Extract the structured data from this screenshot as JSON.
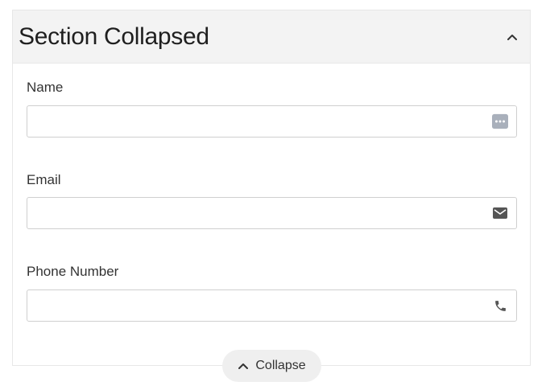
{
  "section": {
    "title": "Section Collapsed",
    "toggle_icon": "chevron-up-icon"
  },
  "fields": [
    {
      "label": "Name",
      "value": "",
      "placeholder": "",
      "icon": "password-dots-icon"
    },
    {
      "label": "Email",
      "value": "",
      "placeholder": "",
      "icon": "mail-icon"
    },
    {
      "label": "Phone Number",
      "value": "",
      "placeholder": "",
      "icon": "phone-icon"
    }
  ],
  "footer": {
    "collapse_label": "Collapse",
    "collapse_icon": "chevron-up-icon"
  }
}
